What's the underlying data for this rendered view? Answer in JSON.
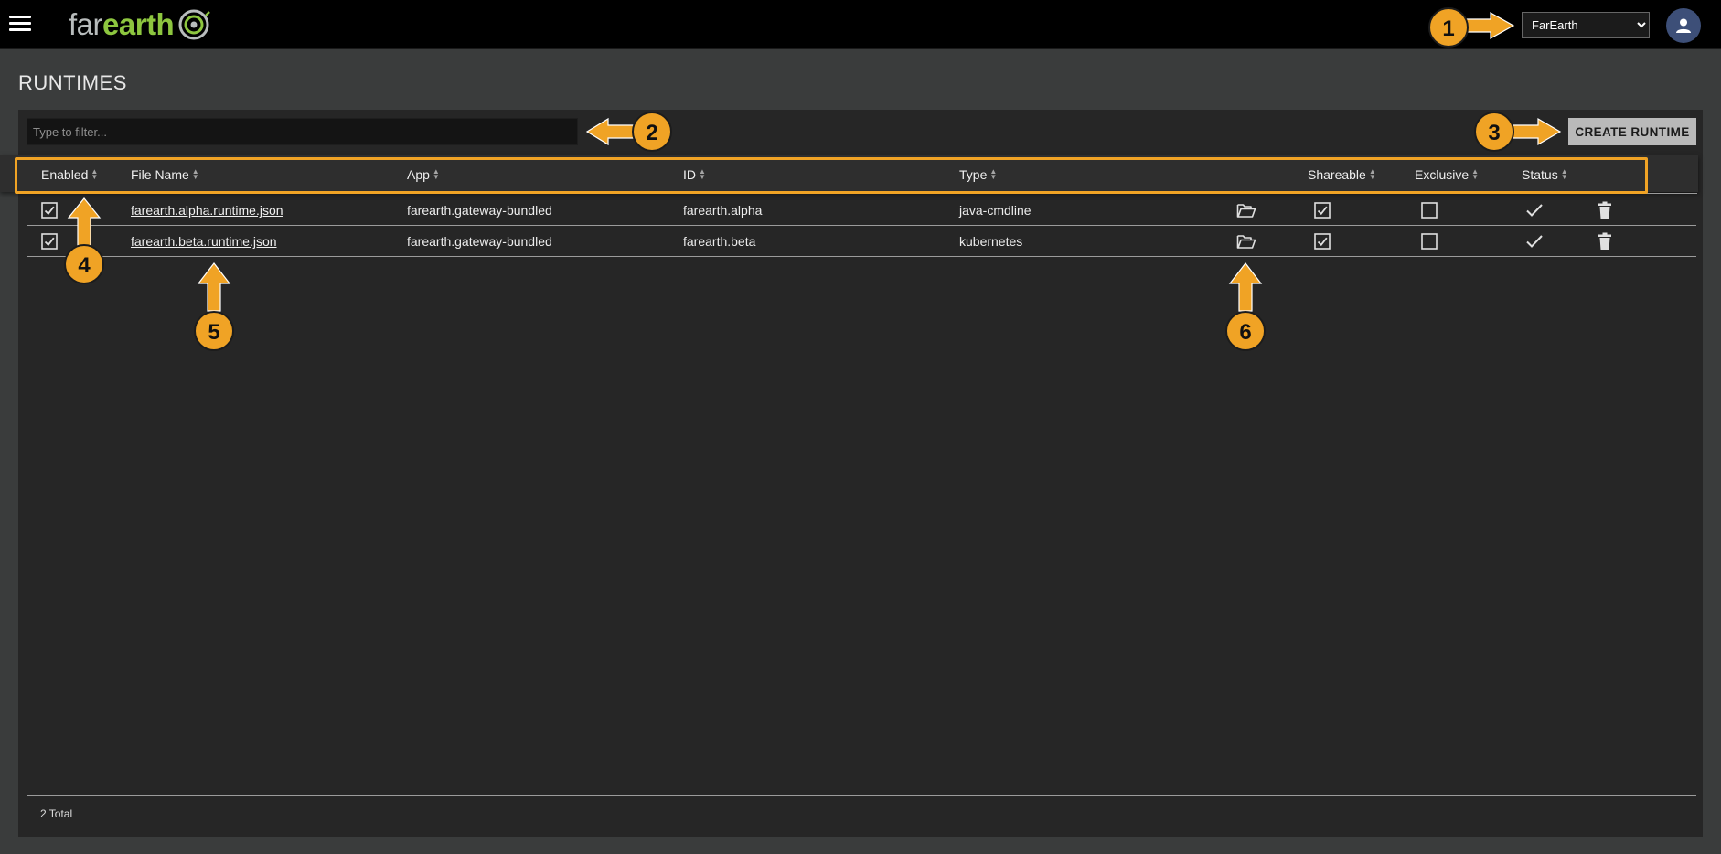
{
  "app": {
    "logo_far": "far",
    "logo_earth": "earth"
  },
  "topbar": {
    "tenant_selected": "FarEarth",
    "tenant_options": [
      "FarEarth"
    ]
  },
  "page": {
    "title": "RUNTIMES"
  },
  "toolbar": {
    "filter_placeholder": "Type to filter...",
    "create_label": "CREATE RUNTIME"
  },
  "table": {
    "columns": {
      "enabled": "Enabled",
      "file_name": "File Name",
      "app": "App",
      "id": "ID",
      "type": "Type",
      "shareable": "Shareable",
      "exclusive": "Exclusive",
      "status": "Status"
    },
    "rows": [
      {
        "enabled": true,
        "file_name": "farearth.alpha.runtime.json",
        "app": "farearth.gateway-bundled",
        "id": "farearth.alpha",
        "type": "java-cmdline",
        "shareable": true,
        "exclusive": false,
        "status": "ok"
      },
      {
        "enabled": true,
        "file_name": "farearth.beta.runtime.json",
        "app": "farearth.gateway-bundled",
        "id": "farearth.beta",
        "type": "kubernetes",
        "shareable": true,
        "exclusive": false,
        "status": "ok"
      }
    ]
  },
  "footer": {
    "total_label": "2 Total"
  },
  "annotations": {
    "callout_1": "1",
    "callout_2": "2",
    "callout_3": "3",
    "callout_4": "4",
    "callout_5": "5",
    "callout_6": "6"
  },
  "colors": {
    "accent_orange": "#f0a325",
    "logo_green": "#8dc63f",
    "avatar_blue": "#3d4f78"
  },
  "icons": {
    "menu": "hamburger-menu-icon",
    "avatar": "user-icon",
    "open": "folder-open-icon",
    "delete": "trash-icon",
    "status_ok": "checkmark-icon",
    "checkbox_checked": "checkbox-checked-icon",
    "checkbox_unchecked": "checkbox-unchecked-icon"
  }
}
